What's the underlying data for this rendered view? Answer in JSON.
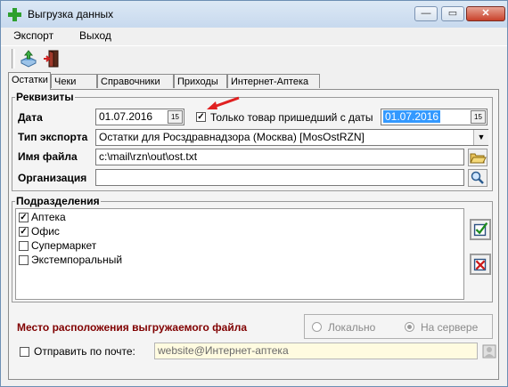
{
  "window": {
    "title": "Выгрузка данных",
    "min_glyph": "—",
    "max_glyph": "▭",
    "close_glyph": "✕"
  },
  "menu": {
    "export": "Экспорт",
    "exit": "Выход"
  },
  "toolbar": {
    "export_icon": "export-icon",
    "exit_icon": "exit-door-icon"
  },
  "tabs": [
    "Остатки",
    "Чеки",
    "Справочники",
    "Приходы",
    "Интернет-Аптека"
  ],
  "requisites": {
    "title": "Реквизиты",
    "date_label": "Дата",
    "date_value": "01.07.2016",
    "only_new_label": "Только товар пришедший с даты",
    "only_new_checked": true,
    "from_date_value": "01.07.2016",
    "export_type_label": "Тип экспорта",
    "export_type_value": "Остатки для Росздравнадзора (Москва) [MosOstRZN]",
    "file_name_label": "Имя файла",
    "file_name_value": "c:\\mail\\rzn\\out\\ost.txt",
    "org_label": "Организация",
    "org_value": "",
    "cal_glyph": "15"
  },
  "departments": {
    "title": "Подразделения",
    "items": [
      {
        "label": "Аптека",
        "checked": true
      },
      {
        "label": "Офис",
        "checked": true
      },
      {
        "label": "Супермаркет",
        "checked": false
      },
      {
        "label": "Экстемпоральный",
        "checked": false
      }
    ]
  },
  "location": {
    "label": "Место расположения выгружаемого файла",
    "local": "Локально",
    "server": "На сервере",
    "selected": "server"
  },
  "email": {
    "label": "Отправить по почте:",
    "checked": false,
    "value": "website@Интернет-аптека"
  },
  "colors": {
    "accent_red": "#800000",
    "selection": "#3399ff",
    "arrow": "#e02020"
  }
}
